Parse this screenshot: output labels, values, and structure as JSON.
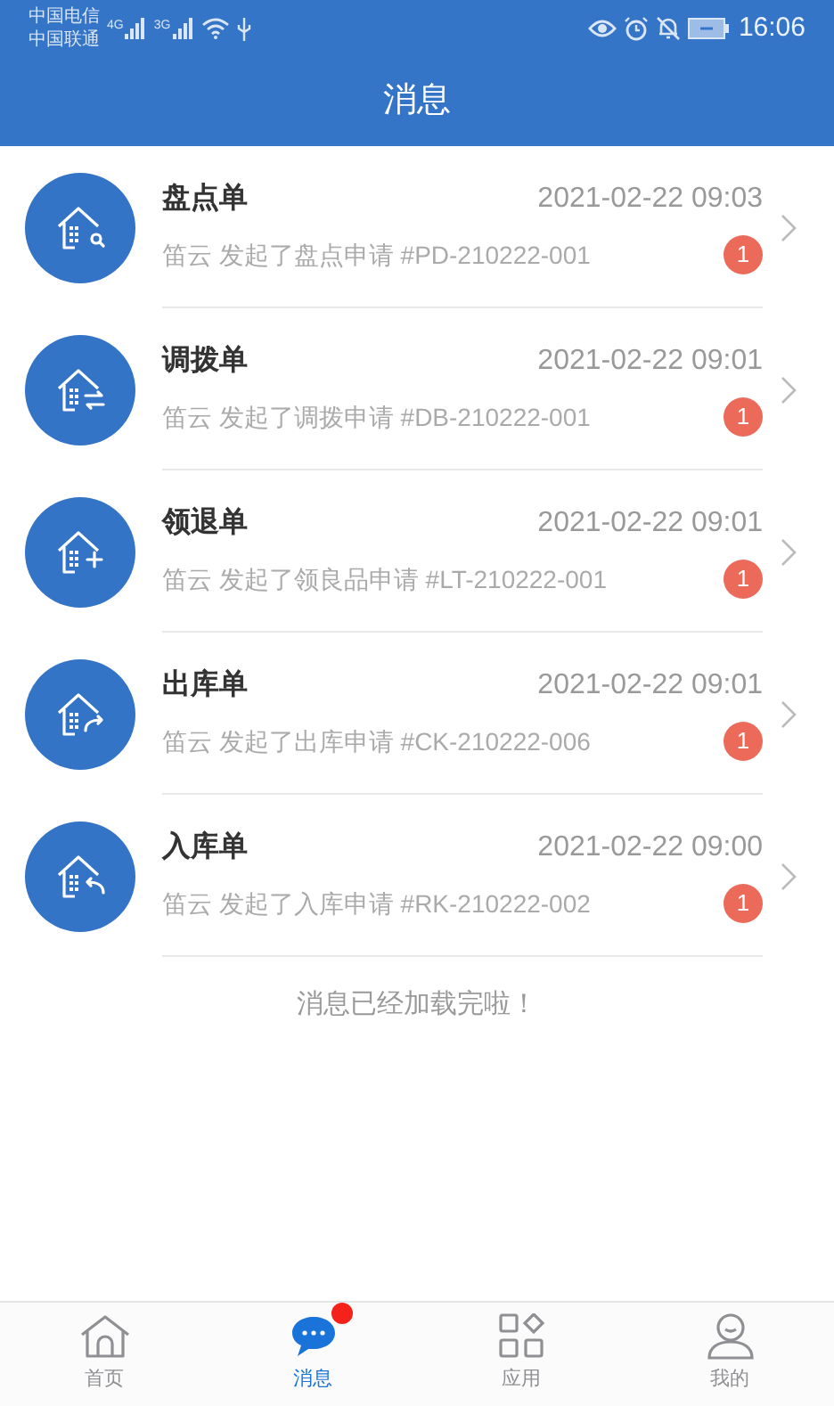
{
  "status_bar": {
    "carriers": [
      "中国电信",
      "中国联通"
    ],
    "networks": [
      "4G",
      "3G"
    ],
    "time": "16:06"
  },
  "header": {
    "title": "消息"
  },
  "messages": [
    {
      "kind": "check",
      "title": "盘点单",
      "time": "2021-02-22 09:03",
      "text": "笛云 发起了盘点申请 #PD-210222-001",
      "count": "1"
    },
    {
      "kind": "transfer",
      "title": "调拨单",
      "time": "2021-02-22 09:01",
      "text": "笛云 发起了调拨申请 #DB-210222-001",
      "count": "1"
    },
    {
      "kind": "return",
      "title": "领退单",
      "time": "2021-02-22 09:01",
      "text": "笛云 发起了领良品申请 #LT-210222-001",
      "count": "1"
    },
    {
      "kind": "outbound",
      "title": "出库单",
      "time": "2021-02-22 09:01",
      "text": "笛云 发起了出库申请 #CK-210222-006",
      "count": "1"
    },
    {
      "kind": "inbound",
      "title": "入库单",
      "time": "2021-02-22 09:00",
      "text": "笛云 发起了入库申请 #RK-210222-002",
      "count": "1"
    }
  ],
  "footer": "消息已经加载完啦！",
  "tabs": [
    {
      "kind": "home",
      "label": "首页",
      "selected": false,
      "dot": false
    },
    {
      "kind": "message",
      "label": "消息",
      "selected": true,
      "dot": true
    },
    {
      "kind": "apps",
      "label": "应用",
      "selected": false,
      "dot": false
    },
    {
      "kind": "me",
      "label": "我的",
      "selected": false,
      "dot": false
    }
  ]
}
